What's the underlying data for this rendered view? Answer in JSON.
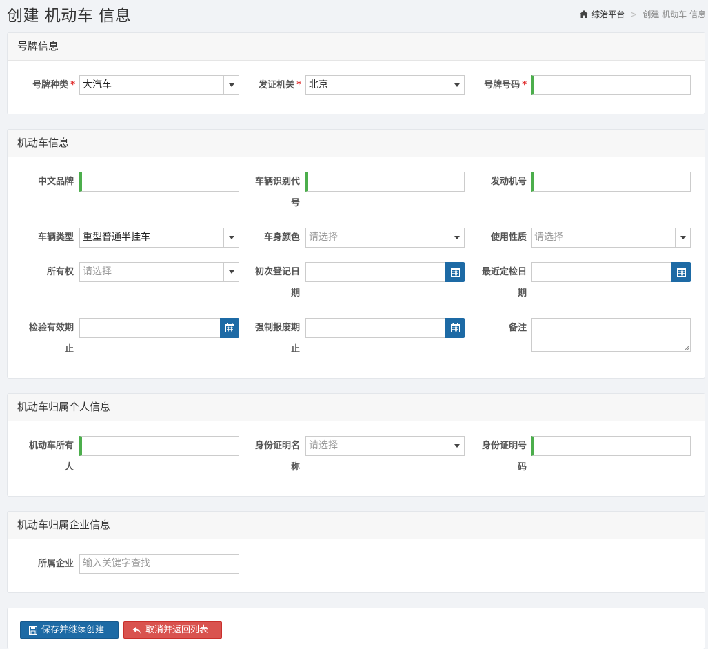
{
  "header": {
    "title": "创建 机动车 信息",
    "breadcrumb_home": "综治平台",
    "breadcrumb_current": "创建 机动车 信息"
  },
  "plate_panel": {
    "title": "号牌信息",
    "plate_type_label": "号牌种类",
    "plate_type_value": "大汽车",
    "issuer_label": "发证机关",
    "issuer_value": "北京",
    "plate_number_label": "号牌号码",
    "plate_number_value": "",
    "required_mark": "*"
  },
  "vehicle_panel": {
    "title": "机动车信息",
    "brand_label": "中文品牌",
    "brand_value": "",
    "vin_label": "车辆识别代号",
    "vin_value": "",
    "engine_label": "发动机号",
    "engine_value": "",
    "vehicle_type_label": "车辆类型",
    "vehicle_type_value": "重型普通半挂车",
    "color_label": "车身颜色",
    "color_placeholder": "请选择",
    "usage_label": "使用性质",
    "usage_placeholder": "请选择",
    "ownership_label": "所有权",
    "ownership_placeholder": "请选择",
    "first_reg_label": "初次登记日期",
    "first_reg_value": "",
    "recent_check_label": "最近定检日期",
    "recent_check_value": "",
    "valid_until_label": "检验有效期止",
    "valid_until_value": "",
    "scrap_label": "强制报废期止",
    "scrap_value": "",
    "remarks_label": "备注",
    "remarks_value": ""
  },
  "person_panel": {
    "title": "机动车归属个人信息",
    "owner_label": "机动车所有人",
    "owner_value": "",
    "id_type_label": "身份证明名称",
    "id_type_placeholder": "请选择",
    "id_number_label": "身份证明号码",
    "id_number_value": ""
  },
  "company_panel": {
    "title": "机动车归属企业信息",
    "company_label": "所属企业",
    "company_placeholder": "输入关键字查找"
  },
  "actions": {
    "save_label": "保存并继续创建",
    "cancel_label": "取消并返回列表"
  },
  "colors": {
    "primary": "#1d6aa5",
    "danger": "#d9534f",
    "required_bar": "#4cae4c",
    "required_star": "#e02a2a"
  }
}
